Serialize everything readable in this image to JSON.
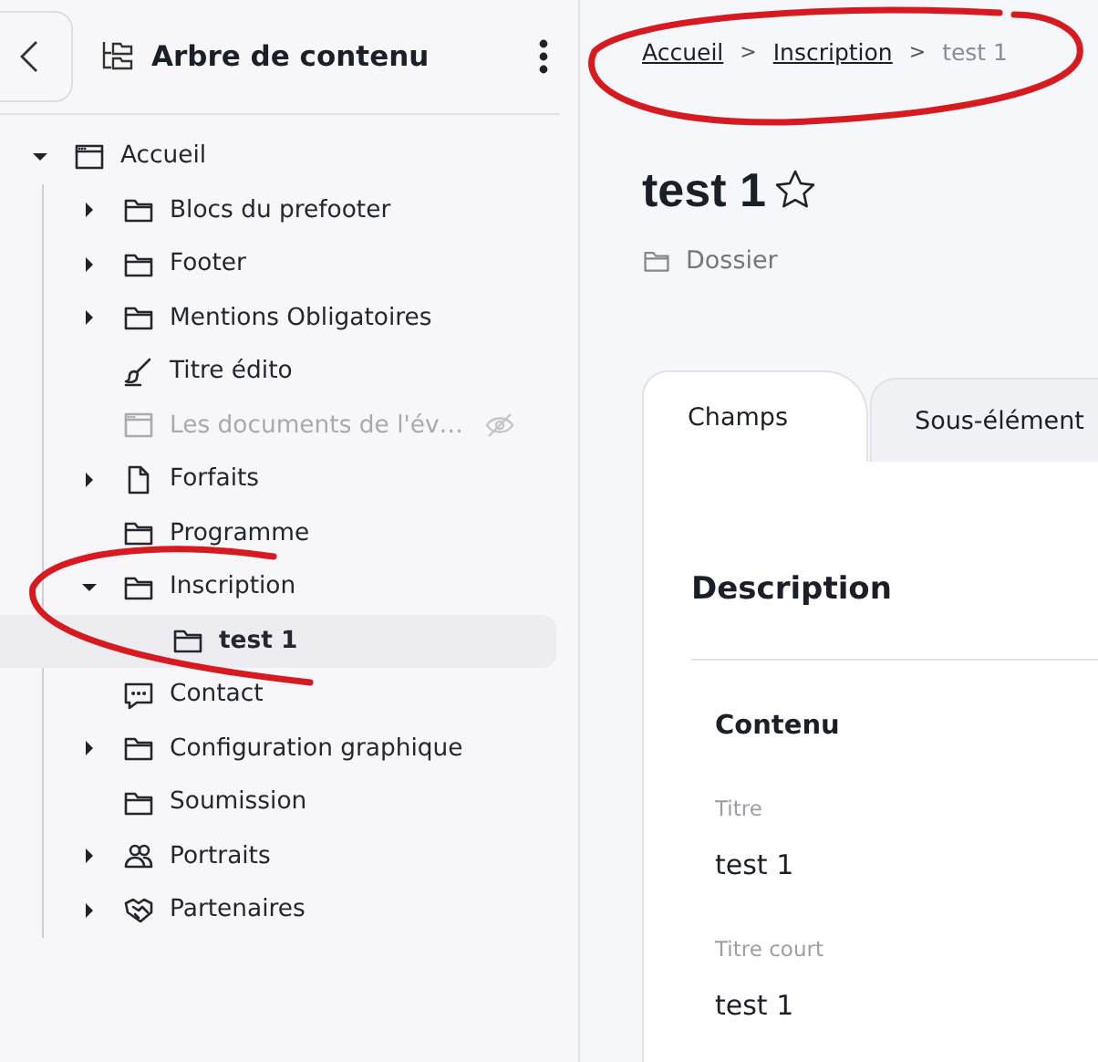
{
  "sidebar": {
    "title": "Arbre de contenu"
  },
  "tree": {
    "items": [
      {
        "label": "Accueil",
        "kind": "window",
        "expanded": true,
        "selected": false,
        "hidden": false,
        "children": [
          {
            "label": "Blocs du prefooter",
            "kind": "folder",
            "expanded": false,
            "selected": false,
            "hidden": false
          },
          {
            "label": "Footer",
            "kind": "folder",
            "expanded": false,
            "selected": false,
            "hidden": false
          },
          {
            "label": "Mentions Obligatoires",
            "kind": "folder",
            "expanded": false,
            "selected": false,
            "hidden": false
          },
          {
            "label": "Titre édito",
            "kind": "brush",
            "selected": false,
            "hidden": false
          },
          {
            "label": "Les documents de l'év…",
            "kind": "window",
            "selected": false,
            "hidden": true
          },
          {
            "label": "Forfaits",
            "kind": "document",
            "expanded": false,
            "selected": false,
            "hidden": false
          },
          {
            "label": "Programme",
            "kind": "folder",
            "selected": false,
            "hidden": false
          },
          {
            "label": "Inscription",
            "kind": "folder",
            "expanded": true,
            "selected": false,
            "hidden": false,
            "children": [
              {
                "label": "test 1",
                "kind": "folder",
                "selected": true,
                "hidden": false
              }
            ]
          },
          {
            "label": "Contact",
            "kind": "chat",
            "selected": false,
            "hidden": false
          },
          {
            "label": "Configuration graphique",
            "kind": "folder",
            "expanded": false,
            "selected": false,
            "hidden": false
          },
          {
            "label": "Soumission",
            "kind": "folder",
            "selected": false,
            "hidden": false
          },
          {
            "label": "Portraits",
            "kind": "people",
            "expanded": false,
            "selected": false,
            "hidden": false
          },
          {
            "label": "Partenaires",
            "kind": "handshake",
            "expanded": false,
            "selected": false,
            "hidden": false
          }
        ]
      }
    ]
  },
  "breadcrumb": {
    "separator": ">",
    "items": [
      {
        "label": "Accueil",
        "link": true
      },
      {
        "label": "Inscription",
        "link": true
      },
      {
        "label": "test 1",
        "link": false
      }
    ]
  },
  "page": {
    "title": "test 1",
    "favorite": false,
    "type": "Dossier"
  },
  "tabs": [
    {
      "label": "Champs",
      "selected": true
    },
    {
      "label": "Sous-élément",
      "selected": false
    }
  ],
  "section": {
    "title": "Description",
    "group": "Contenu",
    "fields": [
      {
        "label": "Titre",
        "value": "test 1"
      },
      {
        "label": "Titre court",
        "value": "test 1"
      }
    ]
  }
}
